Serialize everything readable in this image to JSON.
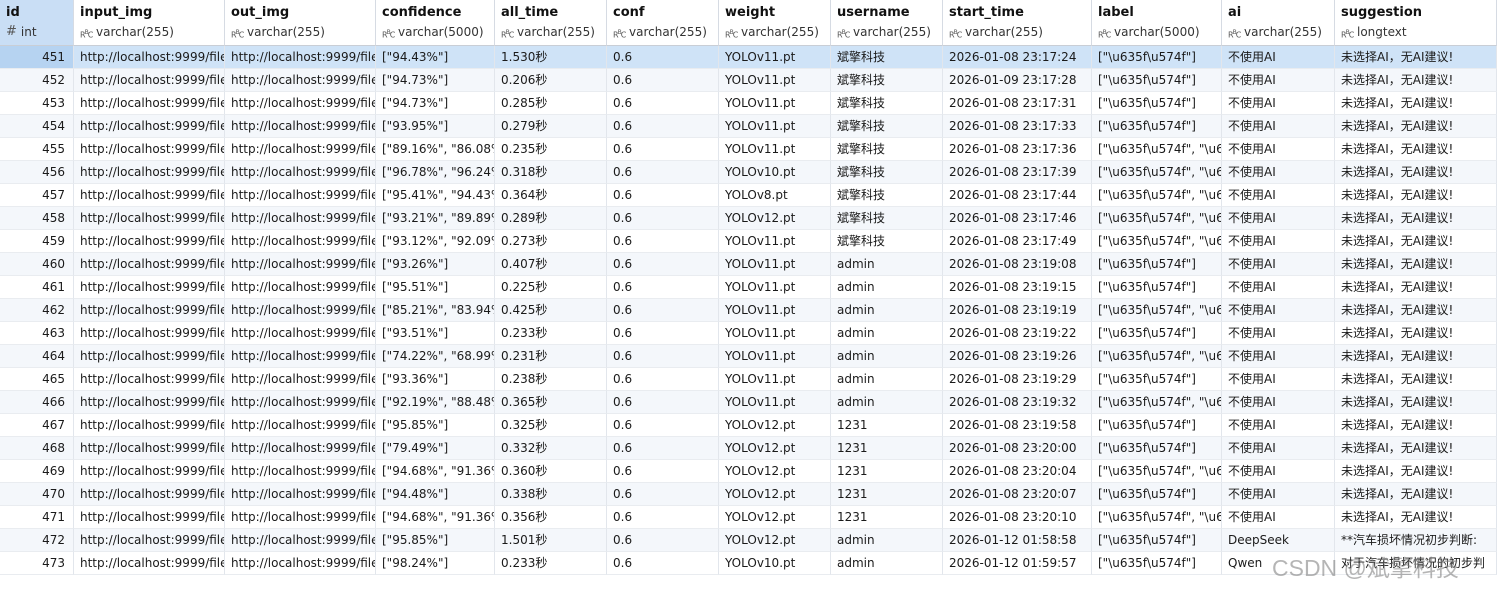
{
  "columns": [
    {
      "name": "id",
      "type": "int",
      "type_icon": "hash-icon"
    },
    {
      "name": "input_img",
      "type": "varchar(255)",
      "type_icon": "text-type-icon"
    },
    {
      "name": "out_img",
      "type": "varchar(255)",
      "type_icon": "text-type-icon"
    },
    {
      "name": "confidence",
      "type": "varchar(5000)",
      "type_icon": "text-type-icon"
    },
    {
      "name": "all_time",
      "type": "varchar(255)",
      "type_icon": "text-type-icon"
    },
    {
      "name": "conf",
      "type": "varchar(255)",
      "type_icon": "text-type-icon"
    },
    {
      "name": "weight",
      "type": "varchar(255)",
      "type_icon": "text-type-icon"
    },
    {
      "name": "username",
      "type": "varchar(255)",
      "type_icon": "text-type-icon"
    },
    {
      "name": "start_time",
      "type": "varchar(255)",
      "type_icon": "text-type-icon"
    },
    {
      "name": "label",
      "type": "varchar(5000)",
      "type_icon": "text-type-icon"
    },
    {
      "name": "ai",
      "type": "varchar(255)",
      "type_icon": "text-type-icon"
    },
    {
      "name": "suggestion",
      "type": "longtext",
      "type_icon": "text-type-icon"
    }
  ],
  "selected_row_id": "451",
  "rows": [
    [
      "451",
      "http://localhost:9999/file",
      "http://localhost:9999/file",
      "[\"94.43%\"]",
      "1.530秒",
      "0.6",
      "YOLOv11.pt",
      "斌擎科技",
      "2026-01-08 23:17:24",
      "[\"\\u635f\\u574f\"]",
      "不使用AI",
      "未选择AI，无AI建议!"
    ],
    [
      "452",
      "http://localhost:9999/file",
      "http://localhost:9999/file",
      "[\"94.73%\"]",
      "0.206秒",
      "0.6",
      "YOLOv11.pt",
      "斌擎科技",
      "2026-01-09 23:17:28",
      "[\"\\u635f\\u574f\"]",
      "不使用AI",
      "未选择AI，无AI建议!"
    ],
    [
      "453",
      "http://localhost:9999/file",
      "http://localhost:9999/file",
      "[\"94.73%\"]",
      "0.285秒",
      "0.6",
      "YOLOv11.pt",
      "斌擎科技",
      "2026-01-08 23:17:31",
      "[\"\\u635f\\u574f\"]",
      "不使用AI",
      "未选择AI，无AI建议!"
    ],
    [
      "454",
      "http://localhost:9999/file",
      "http://localhost:9999/file",
      "[\"93.95%\"]",
      "0.279秒",
      "0.6",
      "YOLOv11.pt",
      "斌擎科技",
      "2026-01-08 23:17:33",
      "[\"\\u635f\\u574f\"]",
      "不使用AI",
      "未选择AI，无AI建议!"
    ],
    [
      "455",
      "http://localhost:9999/file",
      "http://localhost:9999/file",
      "[\"89.16%\", \"86.08%",
      "0.235秒",
      "0.6",
      "YOLOv11.pt",
      "斌擎科技",
      "2026-01-08 23:17:36",
      "[\"\\u635f\\u574f\", \"\\u6",
      "不使用AI",
      "未选择AI，无AI建议!"
    ],
    [
      "456",
      "http://localhost:9999/file",
      "http://localhost:9999/file",
      "[\"96.78%\", \"96.24%",
      "0.318秒",
      "0.6",
      "YOLOv10.pt",
      "斌擎科技",
      "2026-01-08 23:17:39",
      "[\"\\u635f\\u574f\", \"\\u6",
      "不使用AI",
      "未选择AI，无AI建议!"
    ],
    [
      "457",
      "http://localhost:9999/file",
      "http://localhost:9999/file",
      "[\"95.41%\", \"94.43%",
      "0.364秒",
      "0.6",
      "YOLOv8.pt",
      "斌擎科技",
      "2026-01-08 23:17:44",
      "[\"\\u635f\\u574f\", \"\\u6",
      "不使用AI",
      "未选择AI，无AI建议!"
    ],
    [
      "458",
      "http://localhost:9999/file",
      "http://localhost:9999/file",
      "[\"93.21%\", \"89.89%",
      "0.289秒",
      "0.6",
      "YOLOv12.pt",
      "斌擎科技",
      "2026-01-08 23:17:46",
      "[\"\\u635f\\u574f\", \"\\u6",
      "不使用AI",
      "未选择AI，无AI建议!"
    ],
    [
      "459",
      "http://localhost:9999/file",
      "http://localhost:9999/file",
      "[\"93.12%\", \"92.09%",
      "0.273秒",
      "0.6",
      "YOLOv11.pt",
      "斌擎科技",
      "2026-01-08 23:17:49",
      "[\"\\u635f\\u574f\", \"\\u6",
      "不使用AI",
      "未选择AI，无AI建议!"
    ],
    [
      "460",
      "http://localhost:9999/file",
      "http://localhost:9999/file",
      "[\"93.26%\"]",
      "0.407秒",
      "0.6",
      "YOLOv11.pt",
      "admin",
      "2026-01-08 23:19:08",
      "[\"\\u635f\\u574f\"]",
      "不使用AI",
      "未选择AI，无AI建议!"
    ],
    [
      "461",
      "http://localhost:9999/file",
      "http://localhost:9999/file",
      "[\"95.51%\"]",
      "0.225秒",
      "0.6",
      "YOLOv11.pt",
      "admin",
      "2026-01-08 23:19:15",
      "[\"\\u635f\\u574f\"]",
      "不使用AI",
      "未选择AI，无AI建议!"
    ],
    [
      "462",
      "http://localhost:9999/file",
      "http://localhost:9999/file",
      "[\"85.21%\", \"83.94%",
      "0.425秒",
      "0.6",
      "YOLOv11.pt",
      "admin",
      "2026-01-08 23:19:19",
      "[\"\\u635f\\u574f\", \"\\u6",
      "不使用AI",
      "未选择AI，无AI建议!"
    ],
    [
      "463",
      "http://localhost:9999/file",
      "http://localhost:9999/file",
      "[\"93.51%\"]",
      "0.233秒",
      "0.6",
      "YOLOv11.pt",
      "admin",
      "2026-01-08 23:19:22",
      "[\"\\u635f\\u574f\"]",
      "不使用AI",
      "未选择AI，无AI建议!"
    ],
    [
      "464",
      "http://localhost:9999/file",
      "http://localhost:9999/file",
      "[\"74.22%\", \"68.99%",
      "0.231秒",
      "0.6",
      "YOLOv11.pt",
      "admin",
      "2026-01-08 23:19:26",
      "[\"\\u635f\\u574f\", \"\\u6",
      "不使用AI",
      "未选择AI，无AI建议!"
    ],
    [
      "465",
      "http://localhost:9999/file",
      "http://localhost:9999/file",
      "[\"93.36%\"]",
      "0.238秒",
      "0.6",
      "YOLOv11.pt",
      "admin",
      "2026-01-08 23:19:29",
      "[\"\\u635f\\u574f\"]",
      "不使用AI",
      "未选择AI，无AI建议!"
    ],
    [
      "466",
      "http://localhost:9999/file",
      "http://localhost:9999/file",
      "[\"92.19%\", \"88.48%",
      "0.365秒",
      "0.6",
      "YOLOv11.pt",
      "admin",
      "2026-01-08 23:19:32",
      "[\"\\u635f\\u574f\", \"\\u6",
      "不使用AI",
      "未选择AI，无AI建议!"
    ],
    [
      "467",
      "http://localhost:9999/file",
      "http://localhost:9999/file",
      "[\"95.85%\"]",
      "0.325秒",
      "0.6",
      "YOLOv12.pt",
      "1231",
      "2026-01-08 23:19:58",
      "[\"\\u635f\\u574f\"]",
      "不使用AI",
      "未选择AI，无AI建议!"
    ],
    [
      "468",
      "http://localhost:9999/file",
      "http://localhost:9999/file",
      "[\"79.49%\"]",
      "0.332秒",
      "0.6",
      "YOLOv12.pt",
      "1231",
      "2026-01-08 23:20:00",
      "[\"\\u635f\\u574f\"]",
      "不使用AI",
      "未选择AI，无AI建议!"
    ],
    [
      "469",
      "http://localhost:9999/file",
      "http://localhost:9999/file",
      "[\"94.68%\", \"91.36%",
      "0.360秒",
      "0.6",
      "YOLOv12.pt",
      "1231",
      "2026-01-08 23:20:04",
      "[\"\\u635f\\u574f\", \"\\u6",
      "不使用AI",
      "未选择AI，无AI建议!"
    ],
    [
      "470",
      "http://localhost:9999/file",
      "http://localhost:9999/file",
      "[\"94.48%\"]",
      "0.338秒",
      "0.6",
      "YOLOv12.pt",
      "1231",
      "2026-01-08 23:20:07",
      "[\"\\u635f\\u574f\"]",
      "不使用AI",
      "未选择AI，无AI建议!"
    ],
    [
      "471",
      "http://localhost:9999/file",
      "http://localhost:9999/file",
      "[\"94.68%\", \"91.36%",
      "0.356秒",
      "0.6",
      "YOLOv12.pt",
      "1231",
      "2026-01-08 23:20:10",
      "[\"\\u635f\\u574f\", \"\\u6",
      "不使用AI",
      "未选择AI，无AI建议!"
    ],
    [
      "472",
      "http://localhost:9999/file",
      "http://localhost:9999/file",
      "[\"95.85%\"]",
      "1.501秒",
      "0.6",
      "YOLOv12.pt",
      "admin",
      "2026-01-12 01:58:58",
      "[\"\\u635f\\u574f\"]",
      "DeepSeek",
      "**汽车损坏情况初步判断:"
    ],
    [
      "473",
      "http://localhost:9999/file",
      "http://localhost:9999/file",
      "[\"98.24%\"]",
      "0.233秒",
      "0.6",
      "YOLOv10.pt",
      "admin",
      "2026-01-12 01:59:57",
      "[\"\\u635f\\u574f\"]",
      "Qwen",
      "对于汽车损坏情况的初步判"
    ]
  ],
  "watermark": "CSDN @斌擎科技",
  "colors": {
    "selected_row": "#cfe3f7",
    "selected_id_cell": "#b6d3f1",
    "header_first": "#c9def5",
    "alt_row": "#f4f7fb"
  }
}
